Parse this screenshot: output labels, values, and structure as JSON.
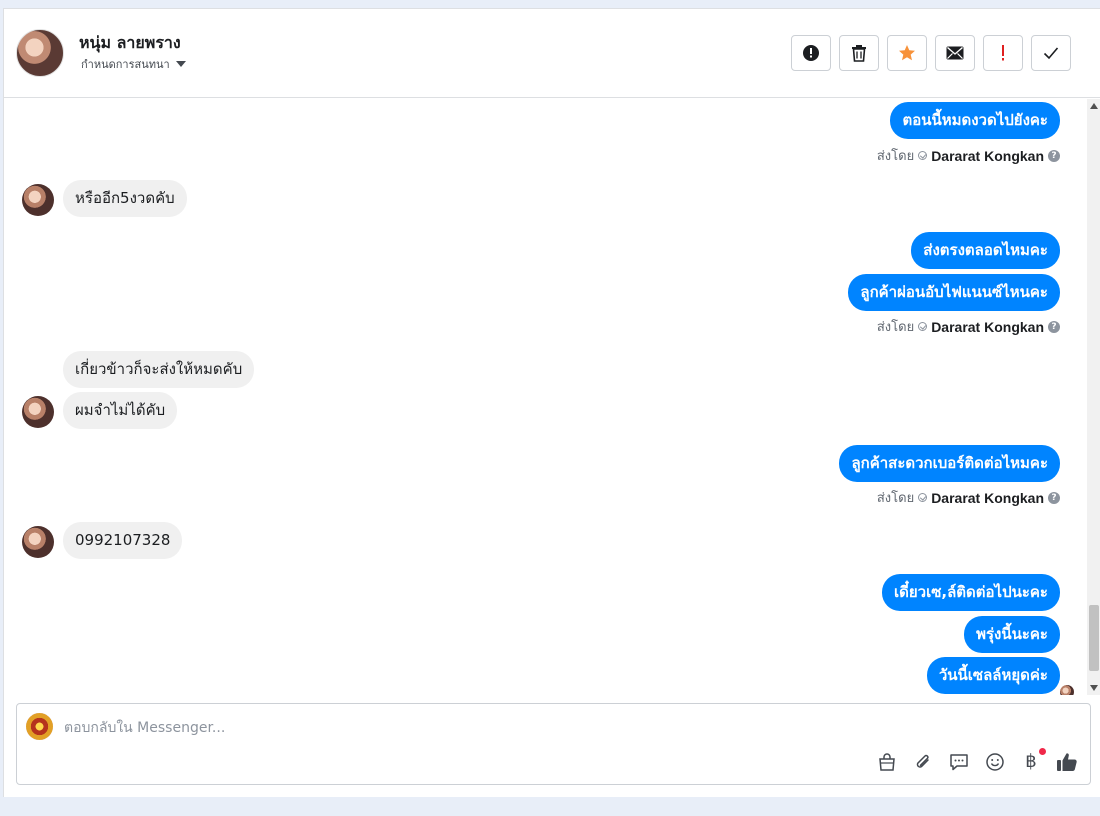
{
  "header": {
    "contact_name": "หนุ่ม ลายพราง",
    "assign_label": "กำหนดการสนทนา",
    "actions": [
      {
        "icon": "alert-circle-icon",
        "name": "spam-button"
      },
      {
        "icon": "trash-icon",
        "name": "delete-button"
      },
      {
        "icon": "star-icon",
        "name": "star-button"
      },
      {
        "icon": "envelope-icon",
        "name": "mark-unread-button"
      },
      {
        "icon": "exclamation-icon",
        "name": "follow-up-button"
      },
      {
        "icon": "checkmark-icon",
        "name": "done-button"
      }
    ]
  },
  "conversation": {
    "sent_by_label": "ส่งโดย",
    "agent_name": "Dararat Kongkan",
    "messages": [
      {
        "direction": "out",
        "text": "ตอนนี้หมดงวดไปยังคะ"
      },
      {
        "direction": "in",
        "text": "หรืออีก5งวดคับ"
      },
      {
        "direction": "out",
        "text": "ส่งตรงตลอดไหมคะ"
      },
      {
        "direction": "out",
        "text": "ลูกค้าผ่อนอับไฟแนนซ์ไหนคะ"
      },
      {
        "direction": "in",
        "text": "เกี่ยวข้าวก็จะส่งให้หมดคับ"
      },
      {
        "direction": "in",
        "text": "ผมจำไม่ได้คับ"
      },
      {
        "direction": "out",
        "text": "ลูกค้าสะดวกเบอร์ติดต่อไหมคะ"
      },
      {
        "direction": "in",
        "text": "0992107328"
      },
      {
        "direction": "out",
        "text": "เดี๋ยวเซ,ล์ติดต่อไปนะคะ"
      },
      {
        "direction": "out",
        "text": "พรุ่งนี้นะคะ"
      },
      {
        "direction": "out",
        "text": "วันนี้เซลล์หยุดค่ะ"
      }
    ]
  },
  "composer": {
    "placeholder": "ตอบกลับใน Messenger...",
    "value": "",
    "tools": [
      "shopping-bag-icon",
      "paperclip-icon",
      "saved-replies-icon",
      "emoji-icon",
      "baht-icon",
      "thumbs-up-icon"
    ],
    "baht_symbol": "฿",
    "colors": {
      "badge": "#f02849"
    }
  },
  "colors": {
    "accent": "#0084ff",
    "incoming_bubble": "#f0f0f0",
    "star": "#f7923a",
    "follow_up": "#e02020"
  }
}
